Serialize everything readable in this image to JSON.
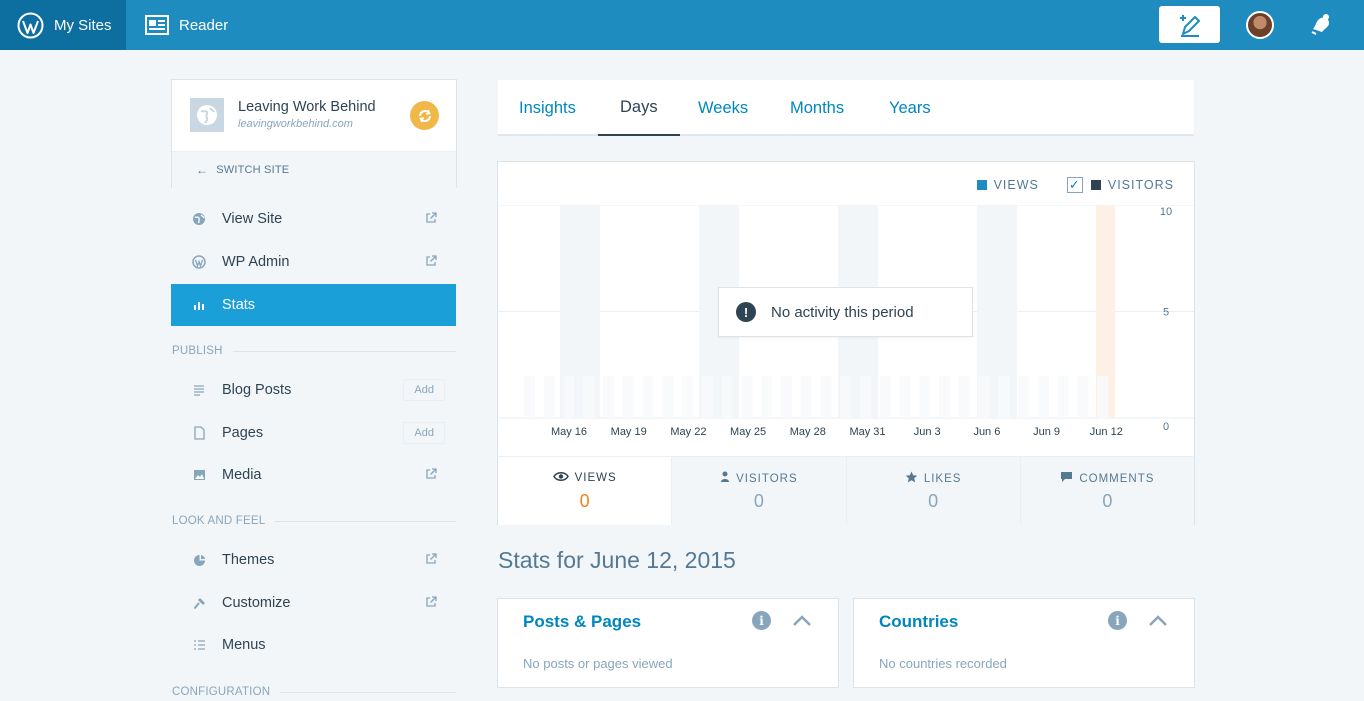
{
  "masterbar": {
    "my_sites": "My Sites",
    "reader": "Reader",
    "colors": {
      "bar": "#1e8cbe",
      "active": "#0d6ea0"
    }
  },
  "site": {
    "title": "Leaving Work Behind",
    "domain": "leavingworkbehind.com",
    "switch_label": "SWITCH SITE"
  },
  "sidebar": {
    "items_top": [
      {
        "label": "View Site",
        "icon": "globe-icon",
        "external": true
      },
      {
        "label": "WP Admin",
        "icon": "wordpress-icon",
        "external": true
      },
      {
        "label": "Stats",
        "icon": "stats-icon",
        "active": true
      }
    ],
    "publish_heading": "PUBLISH",
    "publish_items": [
      {
        "label": "Blog Posts",
        "icon": "posts-icon",
        "add": "Add"
      },
      {
        "label": "Pages",
        "icon": "page-icon",
        "add": "Add"
      },
      {
        "label": "Media",
        "icon": "media-icon",
        "external": true
      }
    ],
    "look_heading": "LOOK AND FEEL",
    "look_items": [
      {
        "label": "Themes",
        "icon": "themes-icon",
        "external": true
      },
      {
        "label": "Customize",
        "icon": "customize-icon",
        "external": true
      },
      {
        "label": "Menus",
        "icon": "menus-icon"
      }
    ],
    "config_heading": "CONFIGURATION",
    "active_color": "#1a9fd8"
  },
  "tabs": {
    "items": [
      "Insights",
      "Days",
      "Weeks",
      "Months",
      "Years"
    ],
    "active": "Days"
  },
  "chart": {
    "legend_views": "VIEWS",
    "legend_visitors": "VISITORS",
    "no_activity": "No activity this period",
    "views_color": "#1e8cbe",
    "visitors_color": "#2e4453"
  },
  "chart_data": {
    "type": "bar",
    "categories": [
      "May 16",
      "May 19",
      "May 22",
      "May 25",
      "May 28",
      "May 31",
      "Jun 3",
      "Jun 6",
      "Jun 9",
      "Jun 12"
    ],
    "series": [
      {
        "name": "VIEWS",
        "values": [
          0,
          0,
          0,
          0,
          0,
          0,
          0,
          0,
          0,
          0
        ]
      },
      {
        "name": "VISITORS",
        "values": [
          0,
          0,
          0,
          0,
          0,
          0,
          0,
          0,
          0,
          0
        ]
      }
    ],
    "y_ticks": [
      "10",
      "5",
      "0"
    ],
    "ylim": [
      0,
      10
    ],
    "grid": true,
    "legend": "top-right"
  },
  "summary": [
    {
      "label": "VIEWS",
      "value": "0",
      "icon": "eye-icon",
      "active": true
    },
    {
      "label": "VISITORS",
      "value": "0",
      "icon": "person-icon"
    },
    {
      "label": "LIKES",
      "value": "0",
      "icon": "star-icon"
    },
    {
      "label": "COMMENTS",
      "value": "0",
      "icon": "comment-icon"
    }
  ],
  "stats_for": "Stats for June 12, 2015",
  "modules": [
    {
      "title": "Posts & Pages",
      "empty": "No posts or pages viewed"
    },
    {
      "title": "Countries",
      "empty": "No countries recorded"
    }
  ]
}
